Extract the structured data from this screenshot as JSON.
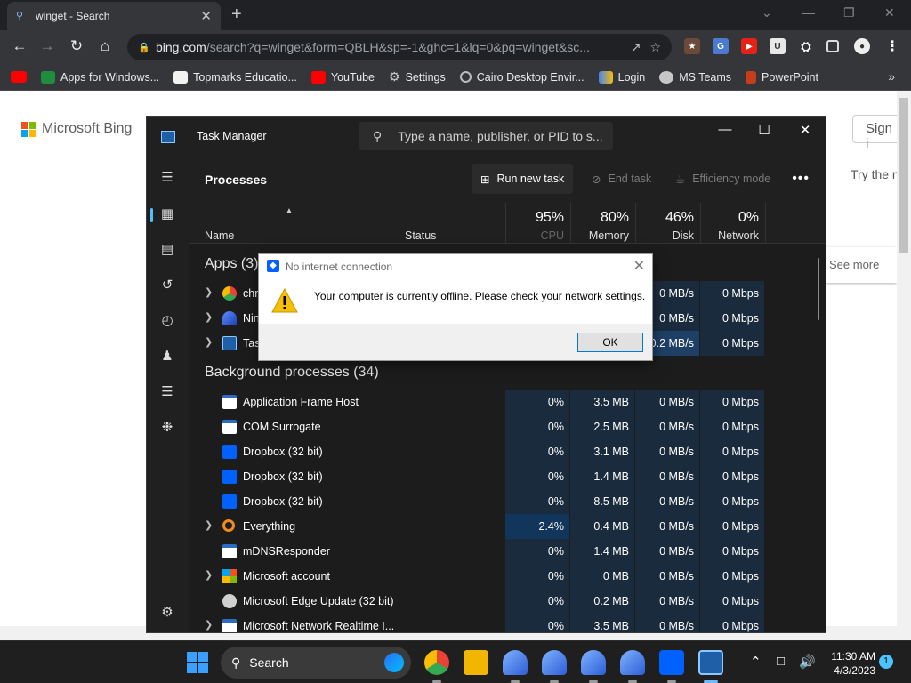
{
  "browser": {
    "tab_title": "winget - Search",
    "url_host": "bing.com",
    "url_rest": "/search?q=winget&form=QBLH&sp=-1&ghc=1&lq=0&pq=winget&sc...",
    "bookmarks": [
      "Apps for Windows...",
      "Topmarks Educatio...",
      "YouTube",
      "Settings",
      "Cairo Desktop Envir...",
      "Login",
      "MS Teams",
      "PowerPoint"
    ]
  },
  "bing": {
    "logo_text": "Microsoft Bing",
    "sign_in": "Sign i",
    "try_text": "Try the n",
    "see_more": "See more"
  },
  "task_manager": {
    "title": "Task Manager",
    "search_placeholder": "Type a name, publisher, or PID to s...",
    "heading": "Processes",
    "toolbar": {
      "run_new_task": "Run new task",
      "end_task": "End task",
      "efficiency_mode": "Efficiency mode"
    },
    "columns": {
      "name": "Name",
      "status": "Status",
      "cpu_pct": "95%",
      "cpu": "CPU",
      "memory_pct": "80%",
      "memory": "Memory",
      "disk_pct": "46%",
      "disk": "Disk",
      "network_pct": "0%",
      "network": "Network"
    },
    "apps_section": "Apps (3)",
    "apps": [
      {
        "name": "chr",
        "disk": "0 MB/s",
        "network": "0 Mbps"
      },
      {
        "name": "Nin",
        "disk": "0 MB/s",
        "network": "0 Mbps"
      },
      {
        "name": "Task",
        "disk": "0.2 MB/s",
        "network": "0 Mbps"
      }
    ],
    "bg_section": "Background processes (34)",
    "background": [
      {
        "name": "Application Frame Host",
        "cpu": "0%",
        "memory": "3.5 MB",
        "disk": "0 MB/s",
        "network": "0 Mbps"
      },
      {
        "name": "COM Surrogate",
        "cpu": "0%",
        "memory": "2.5 MB",
        "disk": "0 MB/s",
        "network": "0 Mbps"
      },
      {
        "name": "Dropbox (32 bit)",
        "cpu": "0%",
        "memory": "3.1 MB",
        "disk": "0 MB/s",
        "network": "0 Mbps"
      },
      {
        "name": "Dropbox (32 bit)",
        "cpu": "0%",
        "memory": "1.4 MB",
        "disk": "0 MB/s",
        "network": "0 Mbps"
      },
      {
        "name": "Dropbox (32 bit)",
        "cpu": "0%",
        "memory": "8.5 MB",
        "disk": "0 MB/s",
        "network": "0 Mbps"
      },
      {
        "name": "Everything",
        "cpu": "2.4%",
        "memory": "0.4 MB",
        "disk": "0 MB/s",
        "network": "0 Mbps"
      },
      {
        "name": "mDNSResponder",
        "cpu": "0%",
        "memory": "1.4 MB",
        "disk": "0 MB/s",
        "network": "0 Mbps"
      },
      {
        "name": "Microsoft account",
        "cpu": "0%",
        "memory": "0 MB",
        "disk": "0 MB/s",
        "network": "0 Mbps"
      },
      {
        "name": "Microsoft Edge Update (32 bit)",
        "cpu": "0%",
        "memory": "0.2 MB",
        "disk": "0 MB/s",
        "network": "0 Mbps"
      },
      {
        "name": "Microsoft Network Realtime I...",
        "cpu": "0%",
        "memory": "3.5 MB",
        "disk": "0 MB/s",
        "network": "0 Mbps"
      }
    ]
  },
  "dialog": {
    "title": "No internet connection",
    "message": "Your computer is currently offline. Please check your network settings.",
    "ok": "OK"
  },
  "taskbar": {
    "search": "Search",
    "time": "11:30 AM",
    "date": "4/3/2023",
    "notifications": "1"
  },
  "colors": {
    "accent": "#4cc2ff",
    "tm_bg": "#202020",
    "dialog_button_border": "#0078d7"
  }
}
